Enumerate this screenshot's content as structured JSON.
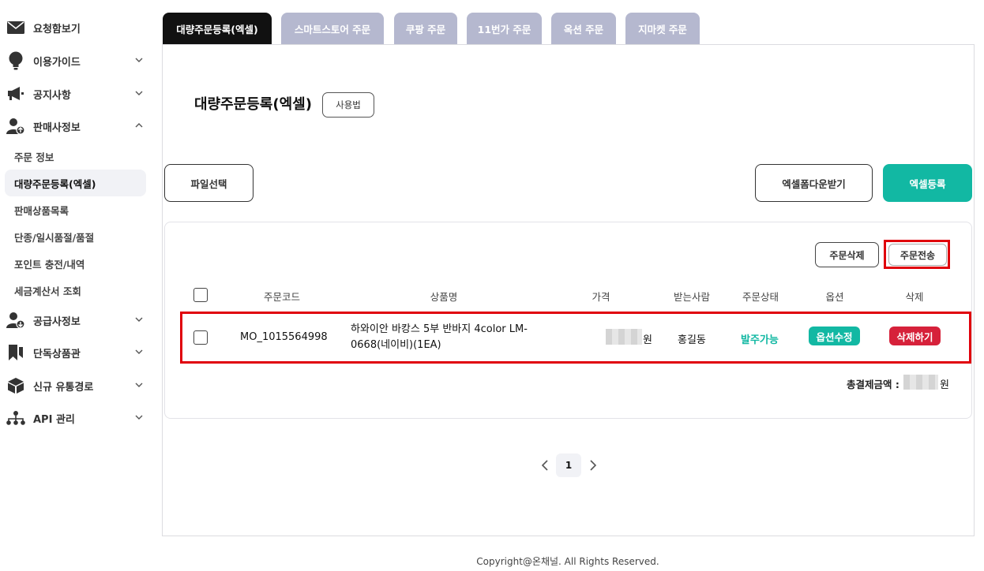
{
  "sidebar": {
    "items": [
      {
        "label": "요청함보기",
        "icon": "envelope-icon"
      },
      {
        "label": "이용가이드",
        "icon": "lightbulb-icon"
      },
      {
        "label": "공지사항",
        "icon": "megaphone-icon"
      },
      {
        "label": "판매사정보",
        "icon": "user-upload-icon"
      },
      {
        "label": "공급사정보",
        "icon": "user-download-icon"
      },
      {
        "label": "단독상품관",
        "icon": "bookmark-icon"
      },
      {
        "label": "신규 유통경로",
        "icon": "box-icon"
      },
      {
        "label": "API 관리",
        "icon": "sitemap-icon"
      }
    ],
    "sub_items": [
      "주문 정보",
      "대량주문등록(엑셀)",
      "판매상품목록",
      "단종/일시품절/품절",
      "포인트 충전/내역",
      "세금계산서 조회"
    ]
  },
  "tabs": [
    "대량주문등록(엑셀)",
    "스마트스토어 주문",
    "쿠팡 주문",
    "11번가 주문",
    "옥션 주문",
    "지마켓 주문"
  ],
  "page": {
    "title": "대량주문등록(엑셀)",
    "help_button": "사용법",
    "file_select_button": "파일선택",
    "excel_download_button": "엑셀폼다운받기",
    "excel_register_button": "엑셀등록"
  },
  "orders": {
    "delete_button": "주문삭제",
    "send_button": "주문전송",
    "columns": [
      "주문코드",
      "상품명",
      "가격",
      "받는사람",
      "주문상태",
      "옵션",
      "삭제"
    ],
    "rows": [
      {
        "order_code": "MO_1015564998",
        "product_line1": "하와이안 바캉스 5부 반바지 4color LM-",
        "product_line2": "0668(네이비)(1EA)",
        "price_unit": "원",
        "recipient": "홍길동",
        "status": "발주가능",
        "option_button": "옵션수정",
        "delete_button": "삭제하기"
      }
    ],
    "total_label": "총결제금액 :",
    "total_unit": "원"
  },
  "pagination": {
    "current": "1"
  },
  "footer": "Copyright@온채널. All Rights Reserved.",
  "colors": {
    "accent": "#12b8a3",
    "danger": "#d6213a",
    "tab_inactive": "#b5b8cf",
    "highlight": "#e0000b"
  }
}
